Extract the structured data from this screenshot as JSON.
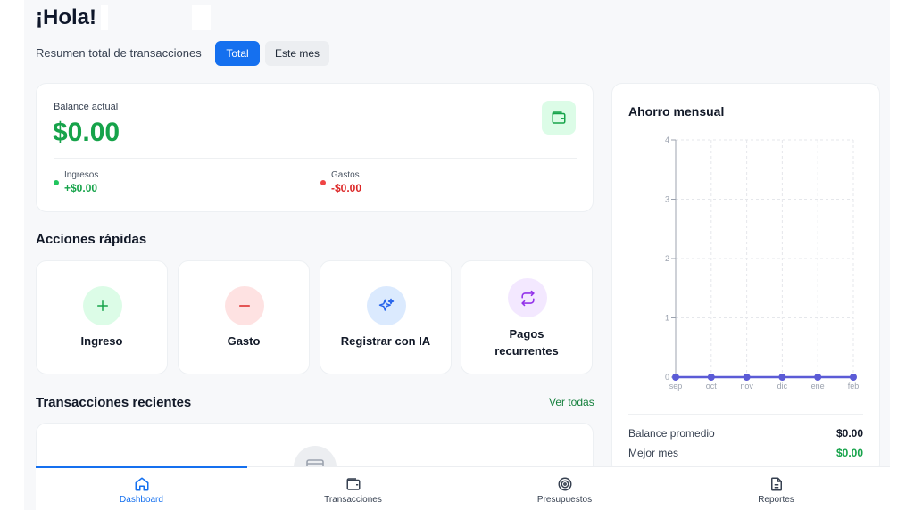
{
  "header": {
    "greeting": "¡Hola!",
    "subtitle": "Resumen total de transacciones",
    "filters": [
      "Total",
      "Este mes"
    ]
  },
  "balance": {
    "label": "Balance actual",
    "value": "$0.00",
    "income_label": "Ingresos",
    "income_value": "+$0.00",
    "expense_label": "Gastos",
    "expense_value": "-$0.00"
  },
  "quick_actions": {
    "title": "Acciones rápidas",
    "items": [
      {
        "label": "Ingreso",
        "icon": "plus-icon",
        "bg": "#dcfce7",
        "color": "#16a34a"
      },
      {
        "label": "Gasto",
        "icon": "minus-icon",
        "bg": "#fee2e2",
        "color": "#dc2626"
      },
      {
        "label": "Registrar con IA",
        "icon": "sparkle-icon",
        "bg": "#dbeafe",
        "color": "#2563eb"
      },
      {
        "label": "Pagos recurrentes",
        "icon": "repeat-icon",
        "bg": "#f3e8ff",
        "color": "#9333ea"
      }
    ]
  },
  "recent": {
    "title": "Transacciones recientes",
    "see_all": "Ver todas"
  },
  "savings": {
    "title": "Ahorro mensual",
    "avg_label": "Balance promedio",
    "avg_value": "$0.00",
    "best_label": "Mejor mes",
    "best_value": "$0.00"
  },
  "chart_data": {
    "type": "line",
    "title": "Ahorro mensual",
    "x": [
      "sep",
      "oct",
      "nov",
      "dic",
      "ene",
      "feb"
    ],
    "series": [
      {
        "values": [
          0,
          0,
          0,
          0,
          0,
          0
        ],
        "color": "#5b5bd6"
      }
    ],
    "ylim": [
      0,
      4
    ],
    "yticks": [
      "0",
      "1",
      "2",
      "3",
      "4"
    ],
    "grid": true
  },
  "nav": {
    "items": [
      {
        "label": "Dashboard",
        "icon": "home-icon",
        "active": true
      },
      {
        "label": "Transacciones",
        "icon": "wallet-icon",
        "active": false
      },
      {
        "label": "Presupuestos",
        "icon": "target-icon",
        "active": false
      },
      {
        "label": "Reportes",
        "icon": "document-icon",
        "active": false
      }
    ]
  },
  "colors": {
    "accent": "#1570ef",
    "positive": "#16a34a",
    "negative": "#dc2626"
  }
}
